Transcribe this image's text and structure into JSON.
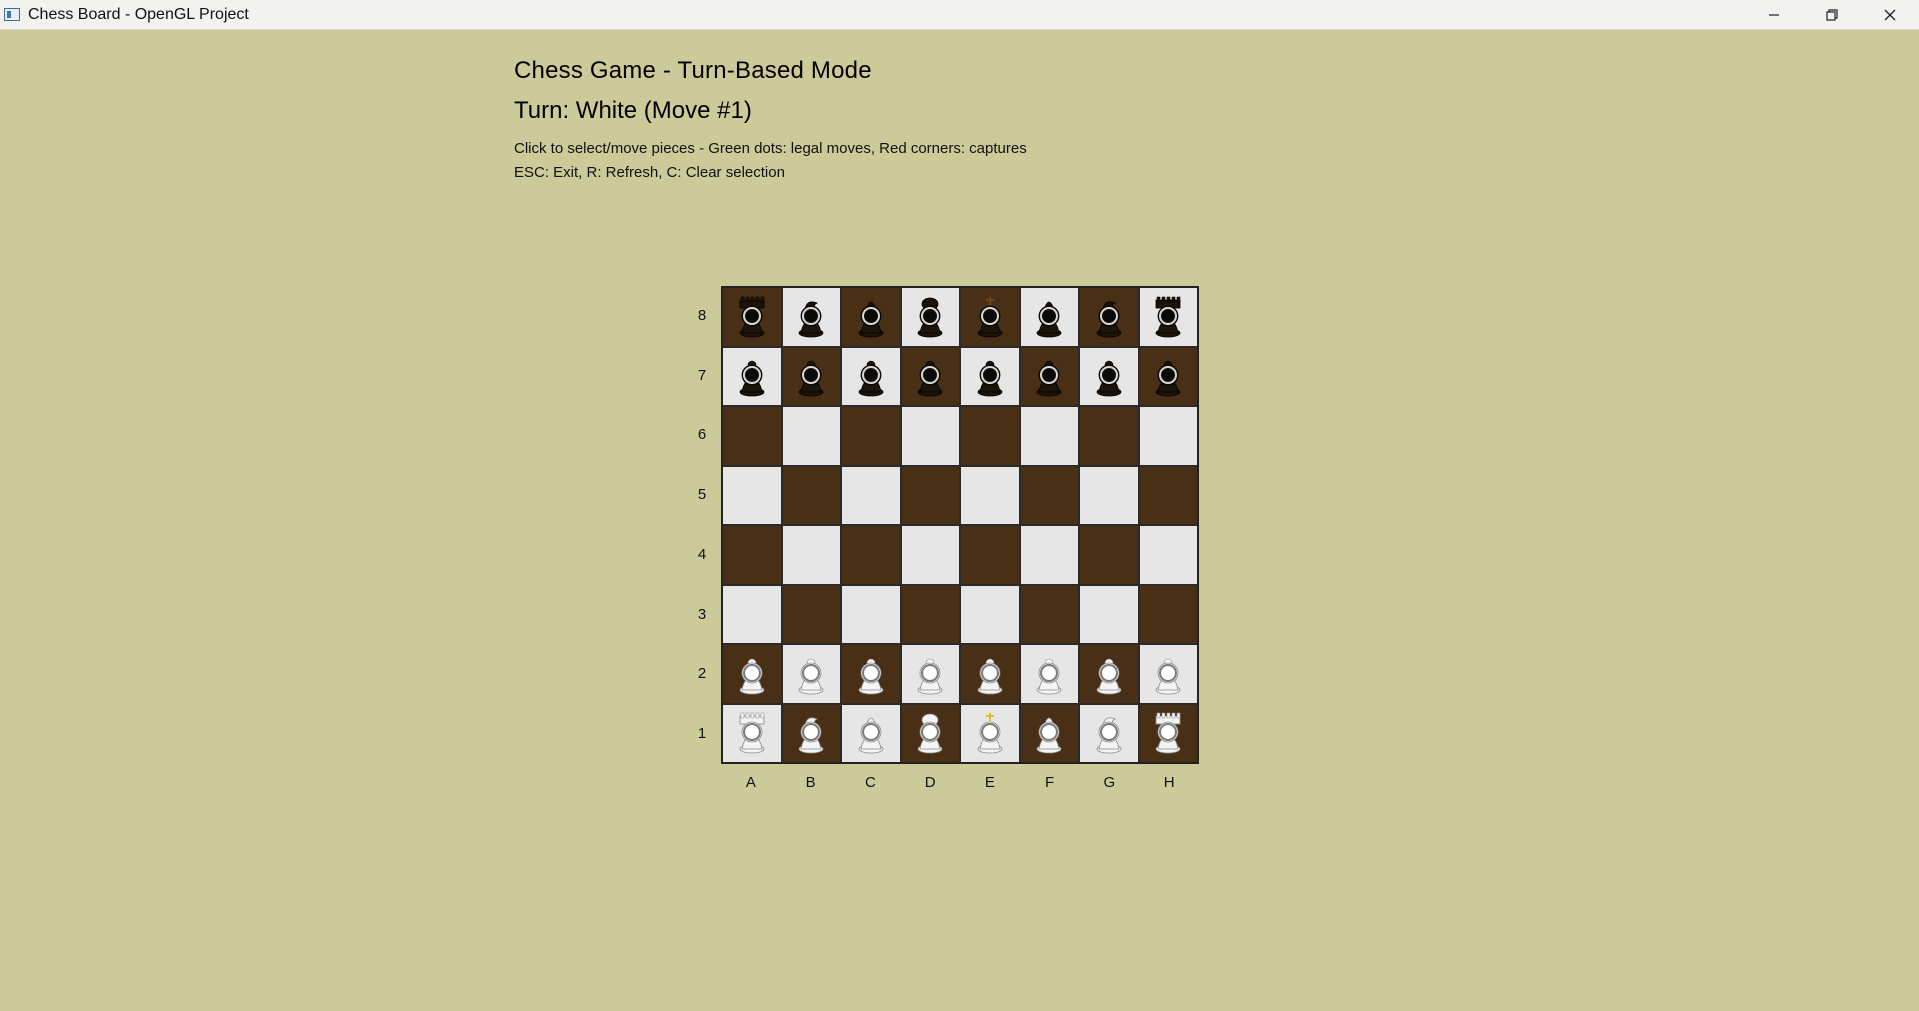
{
  "window": {
    "title": "Chess Board - OpenGL Project",
    "controls": [
      "minimize-icon",
      "restore-icon",
      "close-icon"
    ]
  },
  "header": {
    "title": "Chess Game - Turn-Based Mode",
    "turn": "Turn: White (Move #1)",
    "hint_select": "Click to select/move pieces - Green dots: legal moves, Red corners: captures",
    "hint_keys": "ESC: Exit, R: Refresh, C: Clear selection"
  },
  "board": {
    "ranks": [
      "8",
      "7",
      "6",
      "5",
      "4",
      "3",
      "2",
      "1"
    ],
    "files": [
      "A",
      "B",
      "C",
      "D",
      "E",
      "F",
      "G",
      "H"
    ],
    "colors": {
      "light": "#e6e6e6",
      "dark": "#4a2f17",
      "background": "#cbca98"
    },
    "position": [
      [
        "br",
        "bn",
        "bb",
        "bq",
        "bk",
        "bb",
        "bn",
        "br"
      ],
      [
        "bp",
        "bp",
        "bp",
        "bp",
        "bp",
        "bp",
        "bp",
        "bp"
      ],
      [
        "",
        "",
        "",
        "",
        "",
        "",
        "",
        ""
      ],
      [
        "",
        "",
        "",
        "",
        "",
        "",
        "",
        ""
      ],
      [
        "",
        "",
        "",
        "",
        "",
        "",
        "",
        ""
      ],
      [
        "",
        "",
        "",
        "",
        "",
        "",
        "",
        ""
      ],
      [
        "wp",
        "wp",
        "wp",
        "wp",
        "wp",
        "wp",
        "wp",
        "wp"
      ],
      [
        "wr",
        "wn",
        "wb",
        "wq",
        "wk",
        "wb",
        "wn",
        "wr"
      ]
    ]
  }
}
